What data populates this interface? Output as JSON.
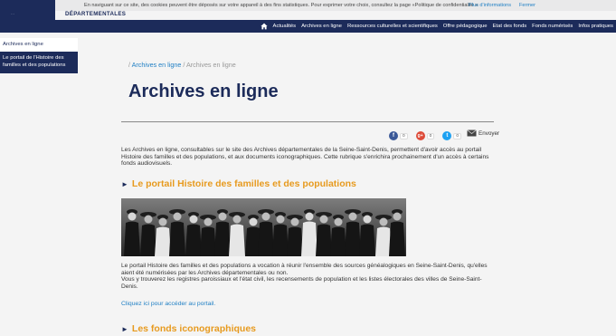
{
  "cookie_bar": {
    "message": "En naviguant sur ce site, des cookies peuvent être déposés sur votre appareil à des fins statistiques. Pour exprimer votre choix, consultez la page «Politique de confidentialité »",
    "more_info": "Plus d'informations",
    "close": "Fermer"
  },
  "header": {
    "brand_top": "…",
    "brand_text": "DÉPARTEMENTALES"
  },
  "nav": {
    "items": [
      "Actualités",
      "Archives en ligne",
      "Ressources culturelles et scientifiques",
      "Offre pédagogique",
      "Etat des fonds",
      "Fonds numérisés",
      "Infos pratiques"
    ]
  },
  "sidebar": {
    "items": [
      {
        "label": "Archives en ligne"
      },
      {
        "label": "Le portail de l'Histoire des familles et des populations"
      }
    ]
  },
  "breadcrumb": {
    "sep": "/",
    "link": "Archives en ligne",
    "current": "Archives en ligne"
  },
  "main": {
    "title": "Archives en ligne",
    "share": {
      "facebook_count": "0",
      "google_count": "0",
      "twitter_count": "0",
      "envoyer": "Envoyer"
    },
    "intro": "Les Archives en ligne, consultables sur le site des Archives départementales de la Seine-Saint-Denis, permettent d'avoir accès au portail Histoire des familles et des populations, et aux documents iconographiques. Cette rubrique s'enrichira prochainement d'un accès à certains fonds audiovisuels.",
    "section1_title": "Le portail Histoire des familles et des populations",
    "portal_p1": "Le portail Histoire des familles et des populations a vocation à réunir l'ensemble des sources généalogiques en Seine-Saint-Denis, qu'elles aient été numérisées par les Archives départementales ou non.",
    "portal_p2": "Vous y trouverez les registres paroissiaux et l'état civil, les recensements de population et les listes électorales des villes de Seine-Saint-Denis.",
    "portal_link": "Cliquez ici pour accéder au portail.",
    "section2_title": "Les fonds iconographiques"
  },
  "colors": {
    "navy": "#1c2b5a",
    "orange": "#e79a1e",
    "link": "#1f7fc4"
  }
}
